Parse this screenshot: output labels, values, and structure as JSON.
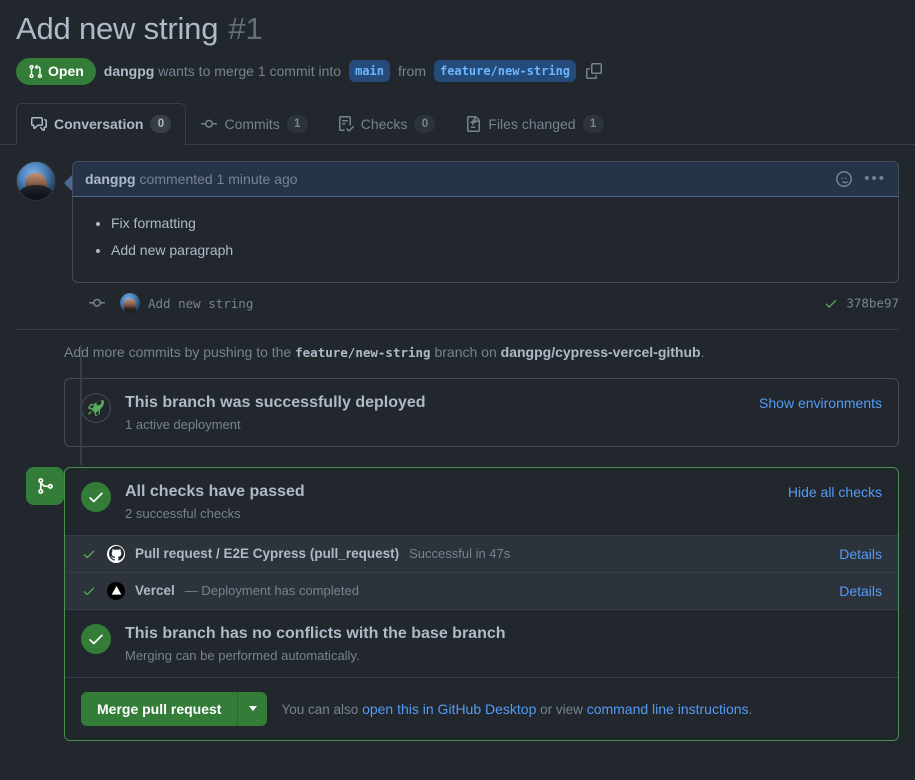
{
  "header": {
    "title": "Add new string",
    "number": "#1",
    "state": "Open",
    "state_icon": "pull-request-icon",
    "state_color": "#347d39",
    "sub_prefix": "dangpg",
    "sub_middle": "wants to merge 1 commit into",
    "base_branch": "main",
    "sub_from": "from",
    "head_branch": "feature/new-string",
    "copy_icon": "copy-icon"
  },
  "tabs": [
    {
      "label": "Conversation",
      "count": "0",
      "icon": "comment-discussion-icon",
      "active": true
    },
    {
      "label": "Commits",
      "count": "1",
      "icon": "git-commit-icon",
      "active": false
    },
    {
      "label": "Checks",
      "count": "0",
      "icon": "checklist-icon",
      "active": false
    },
    {
      "label": "Files changed",
      "count": "1",
      "icon": "file-diff-icon",
      "active": false
    }
  ],
  "comment": {
    "author": "dangpg",
    "meta": "commented 1 minute ago",
    "reaction_icon": "smiley-icon",
    "menu_icon": "kebab-horizontal-icon",
    "body_items": [
      "Fix formatting",
      "Add new paragraph"
    ]
  },
  "commit": {
    "message": "Add new string",
    "sha": "378be97",
    "status_icon": "check-icon",
    "status_color": "#57ab5a"
  },
  "push_hint": {
    "prefix": "Add more commits by pushing to the",
    "branch": "feature/new-string",
    "middle": "branch on",
    "repo": "dangpg/cypress-vercel-github",
    "suffix": "."
  },
  "deployment": {
    "icon": "rocket-icon",
    "title": "This branch was successfully deployed",
    "subtitle": "1 active deployment",
    "link": "Show environments"
  },
  "merge_box": {
    "badge_icon": "git-merge-icon",
    "badge_color": "#347d39",
    "border_color": "#4d8f53",
    "checks": {
      "title": "All checks have passed",
      "subtitle": "2 successful checks",
      "toggle_link": "Hide all checks",
      "rows": [
        {
          "tick_icon": "check-icon",
          "vendor_icon": "github-mark-icon",
          "name": "Pull request / E2E Cypress (pull_request)",
          "description": "Successful in 47s",
          "details_link": "Details"
        },
        {
          "tick_icon": "check-icon",
          "vendor_icon": "vercel-triangle-icon",
          "name": "Vercel",
          "description": "— Deployment has completed",
          "details_link": "Details"
        }
      ]
    },
    "conflicts": {
      "icon": "check-circle-icon",
      "title": "This branch has no conflicts with the base branch",
      "subtitle": "Merging can be performed automatically."
    },
    "actions": {
      "merge_label": "Merge pull request",
      "dropdown_icon": "triangle-down-icon",
      "hint_prefix": "You can also",
      "hint_link_1": "open this in GitHub Desktop",
      "hint_middle": "or view",
      "hint_link_2": "command line instructions",
      "hint_suffix": "."
    }
  }
}
